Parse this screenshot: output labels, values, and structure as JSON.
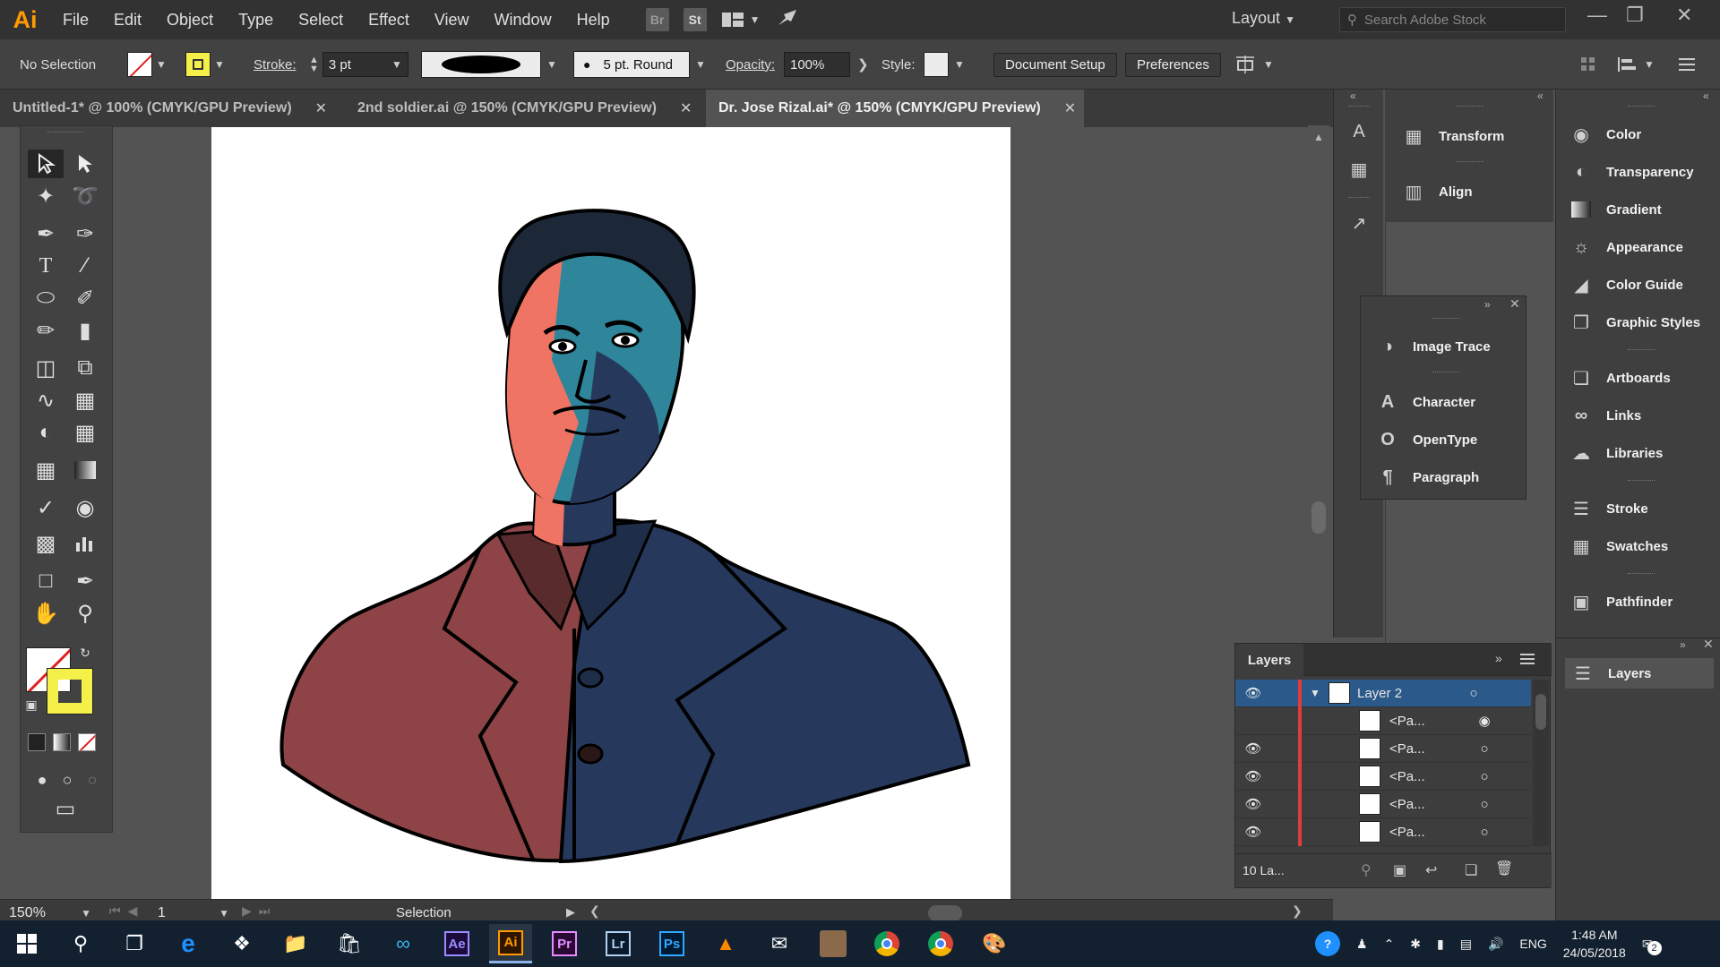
{
  "app": {
    "logo": "Ai"
  },
  "menu": [
    "File",
    "Edit",
    "Object",
    "Type",
    "Select",
    "Effect",
    "View",
    "Window",
    "Help"
  ],
  "menubar_icons": {
    "bridge": "Br",
    "stock": "St"
  },
  "workspace": "Layout",
  "search_stock_placeholder": "Search Adobe Stock",
  "control": {
    "selection": "No Selection",
    "stroke_label": "Stroke:",
    "stroke_value": "3 pt",
    "brush": "5 pt. Round",
    "opacity_label": "Opacity:",
    "opacity_value": "100%",
    "style_label": "Style:",
    "document_setup": "Document Setup",
    "preferences": "Preferences"
  },
  "tabs": [
    {
      "label": "Untitled-1* @ 100% (CMYK/GPU Preview)"
    },
    {
      "label": "2nd soldier.ai @ 150% (CMYK/GPU Preview)"
    },
    {
      "label": "Dr. Jose Rizal.ai* @ 150% (CMYK/GPU Preview)"
    }
  ],
  "status": {
    "zoom": "150%",
    "artboard": "1",
    "tool": "Selection"
  },
  "panels_mid": [
    {
      "label": "Transform",
      "icon": "transform-icon"
    },
    {
      "label": "Align",
      "icon": "align-icon"
    }
  ],
  "panels_float": [
    {
      "label": "Image Trace",
      "icon": "image-trace-icon"
    },
    {
      "label": "Character",
      "icon": "character-icon"
    },
    {
      "label": "OpenType",
      "icon": "opentype-icon"
    },
    {
      "label": "Paragraph",
      "icon": "paragraph-icon"
    }
  ],
  "panels_right": [
    {
      "label": "Color",
      "icon": "color-palette-icon"
    },
    {
      "label": "Transparency",
      "icon": "transparency-icon"
    },
    {
      "label": "Gradient",
      "icon": "gradient-icon"
    },
    {
      "label": "Appearance",
      "icon": "appearance-icon"
    },
    {
      "label": "Color Guide",
      "icon": "color-guide-icon"
    },
    {
      "label": "Graphic Styles",
      "icon": "graphic-styles-icon"
    },
    {
      "label": "Artboards",
      "icon": "artboards-icon"
    },
    {
      "label": "Links",
      "icon": "links-icon"
    },
    {
      "label": "Libraries",
      "icon": "libraries-icon"
    },
    {
      "label": "Stroke",
      "icon": "stroke-icon"
    },
    {
      "label": "Swatches",
      "icon": "swatches-icon"
    },
    {
      "label": "Pathfinder",
      "icon": "pathfinder-icon"
    }
  ],
  "layers_tab": "Layers",
  "layers_panel": {
    "title": "Layers",
    "rows": [
      {
        "name": "Layer 2"
      },
      {
        "name": "<Pa..."
      },
      {
        "name": "<Pa..."
      },
      {
        "name": "<Pa..."
      },
      {
        "name": "<Pa..."
      },
      {
        "name": "<Pa..."
      }
    ],
    "count": "10 La..."
  },
  "taskbar": {
    "apps": [
      "Ae",
      "Ai",
      "Pr",
      "Lr",
      "Ps"
    ],
    "language": "ENG",
    "time": "1:48 AM",
    "date": "24/05/2018",
    "notifications": "2"
  },
  "colors": {
    "accent": "#ff9a00",
    "selected_row": "#2b5a8a",
    "layer_red": "#e03c3c",
    "fill_yellow": "#f5ef4a"
  }
}
